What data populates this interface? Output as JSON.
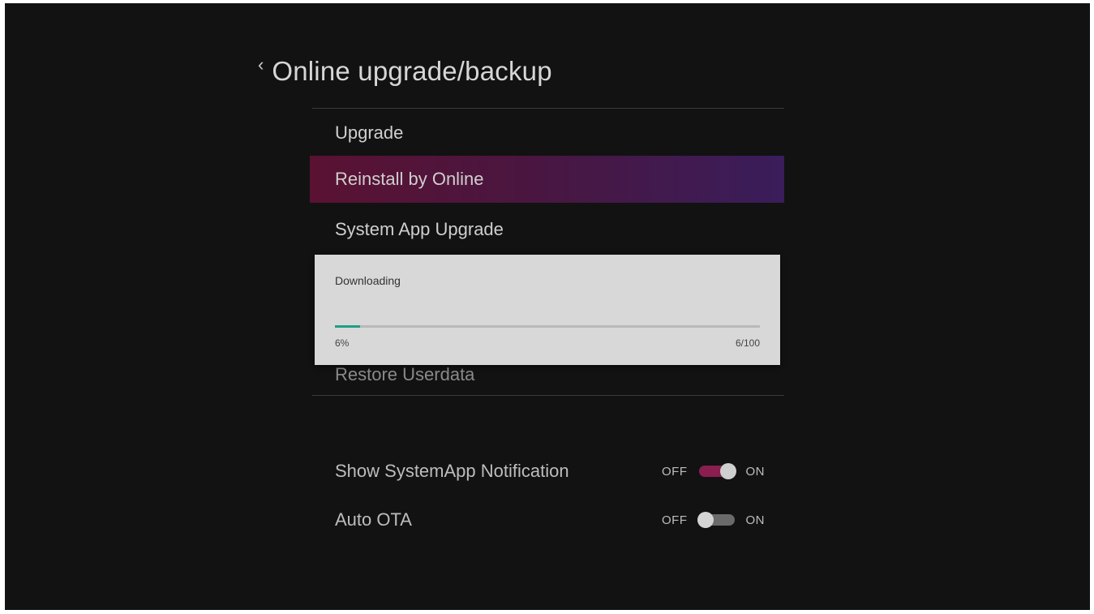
{
  "header": {
    "back_icon": "chevron-left-icon",
    "title": "Online upgrade/backup"
  },
  "menu": {
    "items": [
      {
        "label": "Upgrade"
      },
      {
        "label": "Reinstall by Online"
      },
      {
        "label": "System App Upgrade"
      },
      {
        "label": "Restore Userdata"
      }
    ],
    "selected_index": 1
  },
  "download_dialog": {
    "title": "Downloading",
    "progress_percent": 6,
    "percent_text": "6%",
    "count_text": "6/100",
    "accent_color": "#1f9e86"
  },
  "settings": {
    "show_systemapp_notification": {
      "label": "Show SystemApp Notification",
      "off_label": "OFF",
      "on_label": "ON",
      "state": "on"
    },
    "auto_ota": {
      "label": "Auto OTA",
      "off_label": "OFF",
      "on_label": "ON",
      "state": "off"
    }
  },
  "colors": {
    "background": "#121212",
    "selected_gradient_start": "#5a1232",
    "selected_gradient_end": "#3a1d5a",
    "switch_on": "#8a1e4e"
  }
}
